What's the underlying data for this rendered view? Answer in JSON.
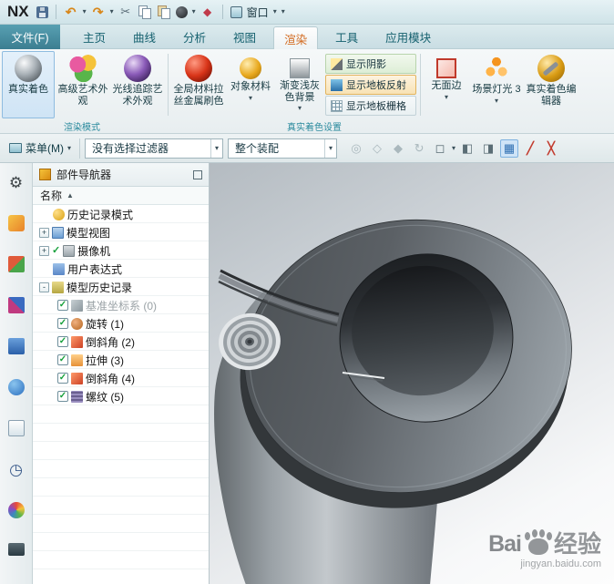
{
  "ui": {
    "caret": "▾",
    "plus": "+",
    "minus": "-",
    "check": "✓",
    "sort": "▲"
  },
  "colors": {
    "active_tab": "#d2691e",
    "group_label": "#2a8a9d",
    "check_green": "#17a03c",
    "titlebar_bg": "#d6e9ee"
  },
  "titlebar": {
    "logo": "NX",
    "window_label": "窗口"
  },
  "tabs": {
    "file": "文件(F)",
    "items": [
      "主页",
      "曲线",
      "分析",
      "视图",
      "渲染",
      "工具",
      "应用模块"
    ],
    "active": "渲染"
  },
  "ribbon": {
    "buttons": [
      {
        "label": "真实着色"
      },
      {
        "label": "高级艺术外观"
      },
      {
        "label": "光线追踪艺术外观"
      },
      {
        "label": "全局材料拉丝金属刷色"
      },
      {
        "label": "对象材料"
      },
      {
        "label": "渐变浅灰色背景"
      },
      {
        "label": "无面边"
      },
      {
        "label": "场景灯光 3"
      },
      {
        "label": "真实着色编辑器"
      }
    ],
    "toggles": [
      {
        "label": "显示阴影"
      },
      {
        "label": "显示地板反射"
      },
      {
        "label": "显示地板栅格"
      }
    ],
    "groups": [
      "渲染模式",
      "真实着色设置"
    ]
  },
  "toolbar": {
    "menu": "菜单(M)",
    "filter": "没有选择过滤器",
    "scope": "整个装配"
  },
  "navigator": {
    "title": "部件导航器",
    "column": "名称",
    "items": [
      {
        "label": "历史记录模式"
      },
      {
        "label": "模型视图"
      },
      {
        "label": "摄像机"
      },
      {
        "label": "用户表达式"
      },
      {
        "label": "模型历史记录"
      },
      {
        "label": "基准坐标系 (0)"
      },
      {
        "label": "旋转 (1)"
      },
      {
        "label": "倒斜角 (2)"
      },
      {
        "label": "拉伸 (3)"
      },
      {
        "label": "倒斜角 (4)"
      },
      {
        "label": "螺纹 (5)"
      }
    ]
  },
  "watermark": {
    "brand": "Bai",
    "suffix": "经验",
    "url": "jingyan.baidu.com"
  }
}
